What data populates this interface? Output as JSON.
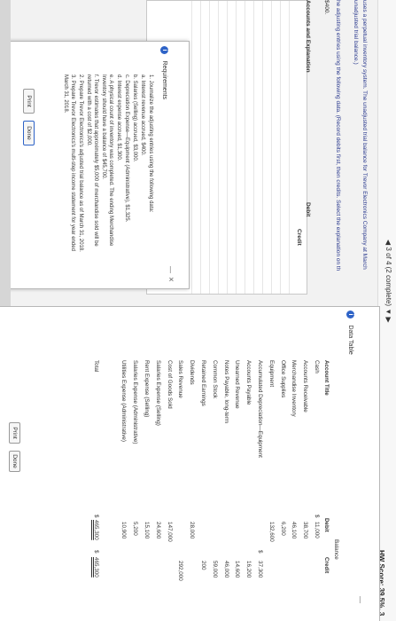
{
  "header": {
    "question_nav": "3 of 4 (2 complete)",
    "score": "HW Score: 39.5%, 3"
  },
  "question": {
    "line1": "uses a perpetual inventory system. The unadjusted trial balance for Trevor Electronics Company at March",
    "line2": "unadjusted trial balance.)",
    "line3": "he adjusting entries using the following data. (Record debits first, then credits. Select the explanation on th",
    "line4": "$400."
  },
  "worksheet": {
    "col_account": "Accounts and Explanation",
    "col_debit": "Debit",
    "col_credit": "Credit"
  },
  "requirements": {
    "title": "Requirements",
    "items": [
      "1.  Journalize the adjusting entries using the following data:",
      "a.  Interest revenue accrued, $400.",
      "b.  Salaries (Selling) accrued, $3,000.",
      "c.  Depreciation Expense—Equipment (Administrative), $1,325.",
      "d.  Interest expense accrued, $1,300.",
      "e.  A physical count of inventory was completed. The ending Merchandise",
      "     Inventory should have a balance of $45,700.",
      "f.  Trevor estimates that approximately $5,000 of merchandise sold will be",
      "     returned with a cost of $2,000.",
      "2.  Prepare Trevor Electronics's adjusted trial balance as of March 31, 2018.",
      "3.  Prepare Trevor Electronics's multi-step income statement for year ended",
      "     March 31, 2018."
    ],
    "print_label": "Print",
    "done_label": "Done",
    "minimize": "—",
    "close": "×"
  },
  "data_table": {
    "title": "Data Table",
    "balance_label": "Balance",
    "col_account": "Account Title",
    "col_debit": "Debit",
    "col_credit": "Credit",
    "rows": [
      {
        "account": "Cash",
        "sym": "$",
        "debit": "11,000",
        "credit": ""
      },
      {
        "account": "Accounts Receivable",
        "sym": "",
        "debit": "38,700",
        "credit": ""
      },
      {
        "account": "Merchandise Inventory",
        "sym": "",
        "debit": "46,100",
        "credit": ""
      },
      {
        "account": "Office Supplies",
        "sym": "",
        "debit": "6,200",
        "credit": ""
      },
      {
        "account": "Equipment",
        "sym": "",
        "debit": "132,600",
        "credit": ""
      },
      {
        "account": "Accumulated Depreciation—Equipment",
        "sym": "$",
        "debit": "",
        "credit": "37,300"
      },
      {
        "account": "Accounts Payable",
        "sym": "",
        "debit": "",
        "credit": "16,200"
      },
      {
        "account": "Unearned Revenue",
        "sym": "",
        "debit": "",
        "credit": "14,600"
      },
      {
        "account": "Notes Payable, long-term",
        "sym": "",
        "debit": "",
        "credit": "46,000"
      },
      {
        "account": "Common Stock",
        "sym": "",
        "debit": "",
        "credit": "59,000"
      },
      {
        "account": "Retained Earnings",
        "sym": "",
        "debit": "",
        "credit": "200"
      },
      {
        "account": "Dividends",
        "sym": "",
        "debit": "28,000",
        "credit": ""
      },
      {
        "account": "Sales Revenue",
        "sym": "",
        "debit": "",
        "credit": "292,000"
      },
      {
        "account": "Cost of Goods Sold",
        "sym": "",
        "debit": "147,000",
        "credit": ""
      },
      {
        "account": "Salaries Expense (Selling)",
        "sym": "",
        "debit": "24,600",
        "credit": ""
      },
      {
        "account": "Rent Expense (Selling)",
        "sym": "",
        "debit": "15,100",
        "credit": ""
      },
      {
        "account": "Salaries Expense (Administrative)",
        "sym": "",
        "debit": "5,200",
        "credit": ""
      },
      {
        "account": "Utilities Expense (Administrative)",
        "sym": "",
        "debit": "10,900",
        "credit": ""
      }
    ],
    "total_label": "Total",
    "total_sym": "$",
    "total_debit": "465,300",
    "total_sym2": "$",
    "total_credit": "465,300",
    "print_label": "Print",
    "done_label": "Done",
    "minimize": "—"
  }
}
